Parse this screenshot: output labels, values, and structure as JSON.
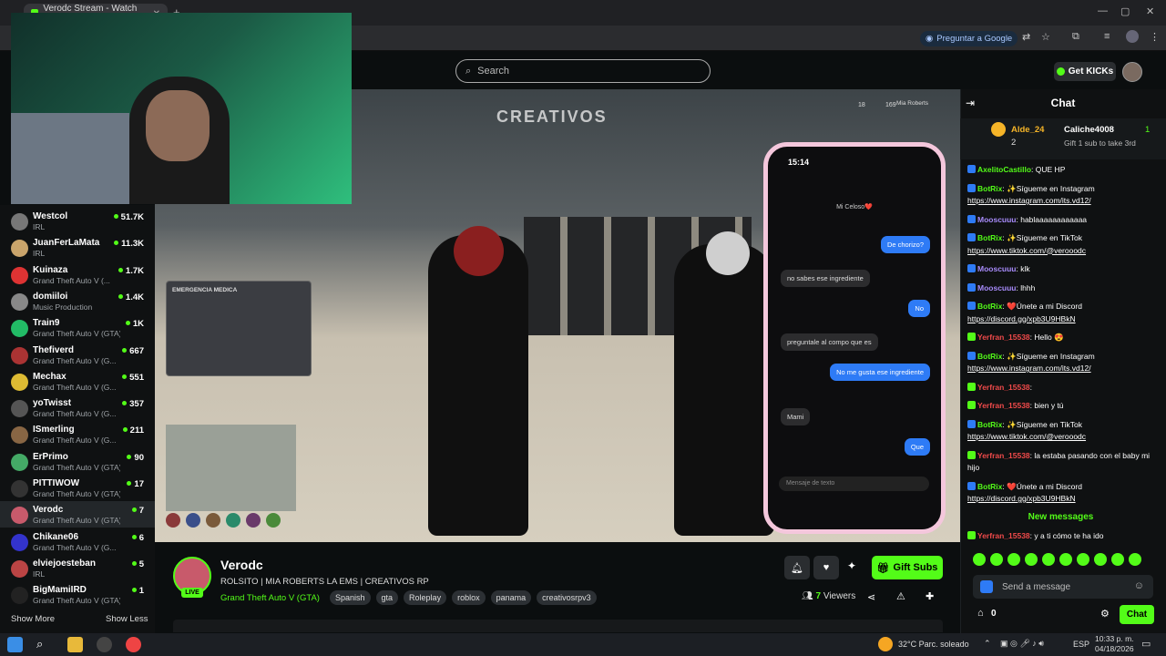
{
  "browser": {
    "tab_title": "Verodc Stream - Watch Live on",
    "google_button": "Preguntar a Google"
  },
  "header": {
    "search_placeholder": "Search",
    "get_kicks": "Get KICKs"
  },
  "sidebar": {
    "channels": [
      {
        "name": "Westcol",
        "category": "IRL",
        "viewers": "51.7K",
        "color": "#777"
      },
      {
        "name": "JuanFerLaMata",
        "category": "IRL",
        "viewers": "11.3K",
        "color": "#c9a46b"
      },
      {
        "name": "Kuinaza",
        "category": "Grand Theft Auto V (...",
        "viewers": "1.7K",
        "color": "#d33"
      },
      {
        "name": "domiiloi",
        "category": "Music Production",
        "viewers": "1.4K",
        "color": "#888"
      },
      {
        "name": "Train9",
        "category": "Grand Theft Auto V (GTA)",
        "viewers": "1K",
        "color": "#2b6"
      },
      {
        "name": "Thefiverd",
        "category": "Grand Theft Auto V (G...",
        "viewers": "667",
        "color": "#a33"
      },
      {
        "name": "Mechax",
        "category": "Grand Theft Auto V (G...",
        "viewers": "551",
        "color": "#db3"
      },
      {
        "name": "yoTwisst",
        "category": "Grand Theft Auto V (G...",
        "viewers": "357",
        "color": "#555"
      },
      {
        "name": "ISmerling",
        "category": "Grand Theft Auto V (G...",
        "viewers": "211",
        "color": "#864"
      },
      {
        "name": "ErPrimo",
        "category": "Grand Theft Auto V (GTA)",
        "viewers": "90",
        "color": "#4a6"
      },
      {
        "name": "PITTIWOW",
        "category": "Grand Theft Auto V (GTA)",
        "viewers": "17",
        "color": "#333"
      },
      {
        "name": "Verodc",
        "category": "Grand Theft Auto V (GTA)",
        "viewers": "7",
        "color": "#c85a6b"
      },
      {
        "name": "Chikane06",
        "category": "Grand Theft Auto V (G...",
        "viewers": "6",
        "color": "#33c"
      },
      {
        "name": "elviejoesteban",
        "category": "IRL",
        "viewers": "5",
        "color": "#b44"
      },
      {
        "name": "BigMamiIRD",
        "category": "Grand Theft Auto V (GTA)",
        "viewers": "1",
        "color": "#222"
      }
    ],
    "show_more": "Show More",
    "show_less": "Show Less"
  },
  "stream": {
    "streamer": "Verodc",
    "live_badge": "LIVE",
    "title": "ROLSITO | MIA ROBERTS LA EMS | CREATIVOS RP",
    "category": "Grand Theft Auto V (GTA)",
    "tags": [
      "Spanish",
      "gta",
      "Roleplay",
      "roblox",
      "panama",
      "creativosrpv3"
    ],
    "viewers_count": "7",
    "viewers_label": "Viewers",
    "gift_subs": "Gift Subs"
  },
  "game_overlay": {
    "logo_text": "CREATIVOS",
    "hud_number_1": "18",
    "hud_number_2": "169",
    "player_name": "Mia Roberts",
    "tablet_title": "EMERGENCIA MEDICA",
    "phone": {
      "time": "15:14",
      "contact": "Mi Celoso❤️",
      "messages": [
        {
          "dir": "out",
          "text": "De chorizo?"
        },
        {
          "dir": "in",
          "text": "no sabes ese ingrediente"
        },
        {
          "dir": "out",
          "text": "No"
        },
        {
          "dir": "in",
          "text": "preguntale al compo que es"
        },
        {
          "dir": "out",
          "text": "No me gusta ese ingrediente"
        },
        {
          "dir": "in",
          "text": "Mami"
        },
        {
          "dir": "out",
          "text": "Que"
        }
      ],
      "input_placeholder": "Mensaje de texto"
    }
  },
  "chat": {
    "title": "Chat",
    "pinned_user1": "Alde_24",
    "pinned_user1_count": "2",
    "pinned_user2": "Caliche4008",
    "pinned_user2_count": "1",
    "pinned_sub": "Gift 1 sub to take 3rd",
    "messages": [
      {
        "user": "AxelitoCastillo",
        "cls": "u-b",
        "text": ": QUE HP"
      },
      {
        "user": "BotRix",
        "cls": "u-b",
        "text": ": ✨Sígueme en Instagram",
        "link": "https://www.instagram.com/its.vd12/"
      },
      {
        "user": "Mooscuuu",
        "cls": "u-p",
        "text": ": hablaaaaaaaaaaaa"
      },
      {
        "user": "BotRix",
        "cls": "u-b",
        "text": ": ✨Sígueme en TikTok",
        "link": "https://www.tiktok.com/@verooodc"
      },
      {
        "user": "Mooscuuu",
        "cls": "u-p",
        "text": ": klk"
      },
      {
        "user": "Mooscuuu",
        "cls": "u-p",
        "text": ": lhhh"
      },
      {
        "user": "BotRix",
        "cls": "u-b",
        "text": ": ❤️Únete a mi Discord",
        "link": "https://discord.gg/xpb3U9HBkN"
      },
      {
        "user": "Yerfran_15538",
        "cls": "u-r",
        "text": ": Hello 😍"
      },
      {
        "user": "BotRix",
        "cls": "u-b",
        "text": ": ✨Sígueme en Instagram",
        "link": "https://www.instagram.com/its.vd12/"
      },
      {
        "user": "Yerfran_15538",
        "cls": "u-r",
        "text": ":"
      },
      {
        "user": "Yerfran_15538",
        "cls": "u-r",
        "text": ": bien y tú"
      },
      {
        "user": "BotRix",
        "cls": "u-b",
        "text": ": ✨Sígueme en TikTok",
        "link": "https://www.tiktok.com/@verooodc"
      },
      {
        "user": "Yerfran_15538",
        "cls": "u-r",
        "text": ": la estaba pasando con el baby mi hijo"
      },
      {
        "user": "BotRix",
        "cls": "u-b",
        "text": ": ❤️Únete a mi Discord",
        "link": "https://discord.gg/xpb3U9HBkN"
      }
    ],
    "new_messages": "New messages",
    "last_message": {
      "user": "Yerfran_15538",
      "text": ": y a ti cómo te ha ido"
    },
    "send_placeholder": "Send a message",
    "kicks_count": "0",
    "chat_button": "Chat"
  },
  "taskbar": {
    "weather": "32°C  Parc. soleado",
    "lang": "ESP",
    "time": "10:33 p. m.",
    "date": "04/18/2026"
  }
}
